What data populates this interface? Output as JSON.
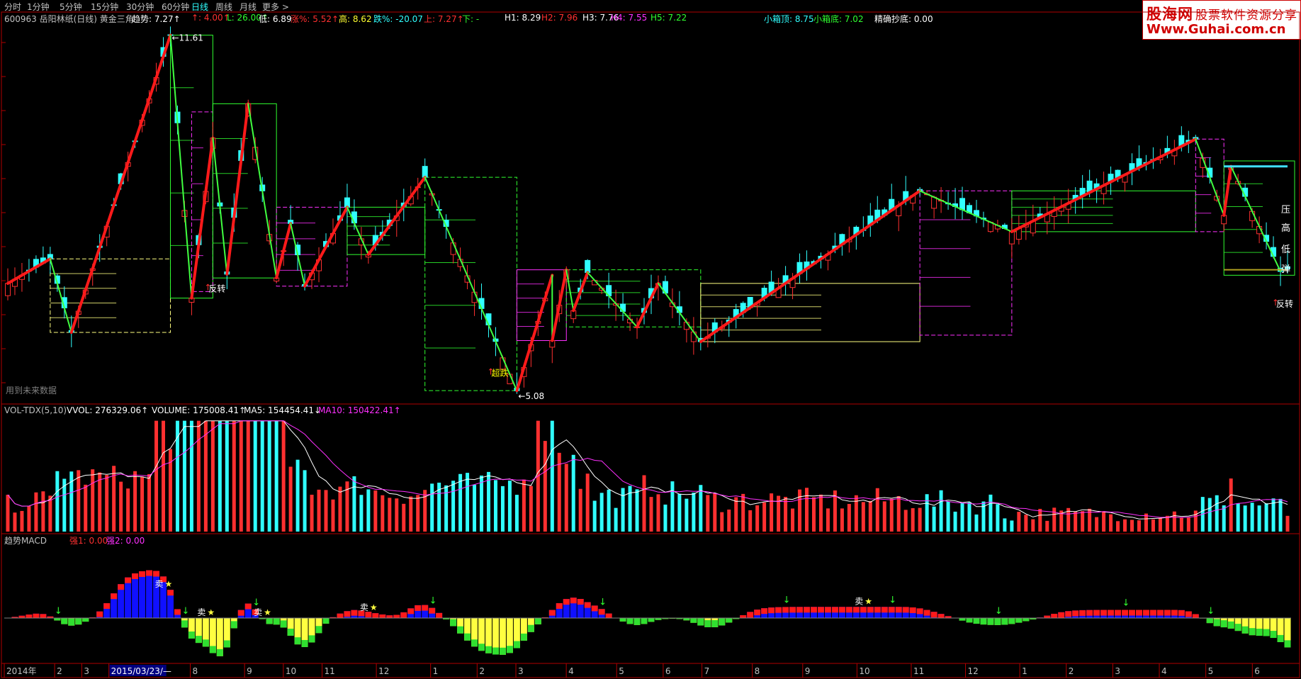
{
  "toolbar": {
    "periods": [
      "分时",
      "1分钟",
      "5分钟",
      "15分钟",
      "30分钟",
      "60分钟",
      "日线",
      "周线",
      "月线",
      "更多 >"
    ],
    "active": "日线"
  },
  "info_bar": {
    "title": "600963 岳阳林纸(日线) 黄金三角",
    "fields": [
      {
        "text": "趋势: 7.27",
        "color": "#ffffff",
        "arrow": "↑"
      },
      {
        "text": "↑: 4.00",
        "color": "#ff3030",
        "arrow": "↑"
      },
      {
        "text": "L: 26.00",
        "color": "#30ff30",
        "arrow": "↑"
      },
      {
        "text": "低: 6.89",
        "color": "#ffffff",
        "arrow": ""
      },
      {
        "text": "涨%: 5.52",
        "color": "#ff3030",
        "arrow": "↑"
      },
      {
        "text": "高: 8.62",
        "color": "#ffff30",
        "arrow": ""
      },
      {
        "text": "跌%: -20.07",
        "color": "#30ffff",
        "arrow": ""
      },
      {
        "text": "上: 7.27",
        "color": "#ff3030",
        "arrow": "↑"
      },
      {
        "text": "下: -",
        "color": "#30ff30",
        "arrow": ""
      },
      {
        "text": "H1: 8.29",
        "color": "#ffffff",
        "arrow": ""
      },
      {
        "text": "H2: 7.96",
        "color": "#ff3030",
        "arrow": ""
      },
      {
        "text": "H3: 7.76",
        "color": "#ffffff",
        "arrow": ""
      },
      {
        "text": "H4: 7.55",
        "color": "#ff30ff",
        "arrow": ""
      },
      {
        "text": "H5: 7.22",
        "color": "#30ff30",
        "arrow": ""
      }
    ],
    "box_top": "小箱顶: 8.75",
    "box_bottom": "小箱底: 7.02",
    "precise_buy": "精确抄底: 0.00"
  },
  "logo": {
    "line1": "股海网",
    "line1b": "股票软件资源分享",
    "line2": "Www.Guhai.com.cn"
  },
  "price_panel": {
    "high_label": "11.61",
    "low_label": "5.08",
    "bottom_left_label": "用到未来数据",
    "annotations": [
      {
        "text": "反转",
        "xi": 29,
        "price": 6.9,
        "color": "#ffffff"
      },
      {
        "text": "超跌",
        "xi": 69,
        "price": 5.35,
        "color": "#ffff00"
      },
      {
        "text": "反转",
        "xi": 180,
        "price": 6.62,
        "color": "#ffffff"
      }
    ],
    "right_labels": [
      "压",
      "高",
      "低",
      "弹"
    ],
    "y_range": [
      4.9,
      11.8
    ]
  },
  "volume_panel": {
    "header": [
      {
        "text": "VOL-TDX(5,10)",
        "color": "#c0c0c0"
      },
      {
        "text": "VVOL: 276329.06",
        "color": "#ffffff",
        "arrow": "↑"
      },
      {
        "text": "VOLUME: 175008.41",
        "color": "#ffffff",
        "arrow": "↑"
      },
      {
        "text": "MA5: 154454.41",
        "color": "#ffffff",
        "arrow": "↓"
      },
      {
        "text": "MA10: 150422.41",
        "color": "#ff30ff",
        "arrow": "↑"
      }
    ]
  },
  "macd_panel": {
    "header": [
      {
        "text": "趋势MACD",
        "color": "#c0c0c0"
      },
      {
        "text": "强1: 0.00",
        "color": "#ff3030"
      },
      {
        "text": "强2: 0.00",
        "color": "#ff30ff"
      }
    ],
    "sell_label": "卖"
  },
  "x_axis": {
    "labels": [
      "2014年",
      "2",
      "3",
      "2015/03/23/—",
      "8",
      "9",
      "10",
      "11",
      "12",
      "1",
      "2",
      "3",
      "4",
      "5",
      "6",
      "7",
      "8",
      "9",
      "10",
      "11",
      "12",
      "1",
      "2",
      "3",
      "4",
      "5",
      "6"
    ]
  },
  "chart_data": {
    "type": "candlestick",
    "title": "600963 岳阳林纸(日线) 黄金三角",
    "n_bars": 182,
    "zigzag_pivots": [
      {
        "i": 0,
        "price": 7.05,
        "trend": "up"
      },
      {
        "i": 6,
        "price": 7.5,
        "trend": "down"
      },
      {
        "i": 9,
        "price": 6.15,
        "trend": "up"
      },
      {
        "i": 23,
        "price": 11.61,
        "trend": "down"
      },
      {
        "i": 26,
        "price": 6.78,
        "trend": "up"
      },
      {
        "i": 29,
        "price": 9.72,
        "trend": "down"
      },
      {
        "i": 31,
        "price": 7.22,
        "trend": "up"
      },
      {
        "i": 34,
        "price": 10.35,
        "trend": "down"
      },
      {
        "i": 38,
        "price": 7.15,
        "trend": "up"
      },
      {
        "i": 40,
        "price": 8.15,
        "trend": "down"
      },
      {
        "i": 42,
        "price": 7.0,
        "trend": "up"
      },
      {
        "i": 48,
        "price": 8.45,
        "trend": "down"
      },
      {
        "i": 51,
        "price": 7.58,
        "trend": "up"
      },
      {
        "i": 59,
        "price": 9.0,
        "trend": "down"
      },
      {
        "i": 72,
        "price": 5.08,
        "trend": "up"
      },
      {
        "i": 77,
        "price": 7.2,
        "trend": "down"
      },
      {
        "i": 77,
        "price": 6.0,
        "trend": "up"
      },
      {
        "i": 79,
        "price": 7.3,
        "trend": "down"
      },
      {
        "i": 80,
        "price": 6.55,
        "trend": "up"
      },
      {
        "i": 82,
        "price": 7.25,
        "trend": "down"
      },
      {
        "i": 89,
        "price": 6.25,
        "trend": "up"
      },
      {
        "i": 92,
        "price": 7.05,
        "trend": "down"
      },
      {
        "i": 98,
        "price": 5.98,
        "trend": "up"
      },
      {
        "i": 129,
        "price": 8.75,
        "trend": "down"
      },
      {
        "i": 142,
        "price": 8.0,
        "trend": "up"
      },
      {
        "i": 168,
        "price": 9.7,
        "trend": "down"
      },
      {
        "i": 172,
        "price": 8.3,
        "trend": "up"
      },
      {
        "i": 173,
        "price": 9.2,
        "trend": "down"
      },
      {
        "i": 180,
        "price": 7.27,
        "trend": "down"
      }
    ],
    "resistance_line": {
      "price": 9.2,
      "from_i": 172,
      "to_i": 182,
      "color": "#40e0ff"
    },
    "support_line": {
      "price": 7.3,
      "from_i": 172,
      "to_i": 182,
      "color": "#b0a020"
    },
    "volume_ylim": [
      0,
      380000
    ],
    "series": [
      {
        "name": "VVOL",
        "color": "#ffffff"
      },
      {
        "name": "MA5",
        "color": "#ffffff"
      },
      {
        "name": "MA10",
        "color": "#ff30ff"
      }
    ]
  }
}
